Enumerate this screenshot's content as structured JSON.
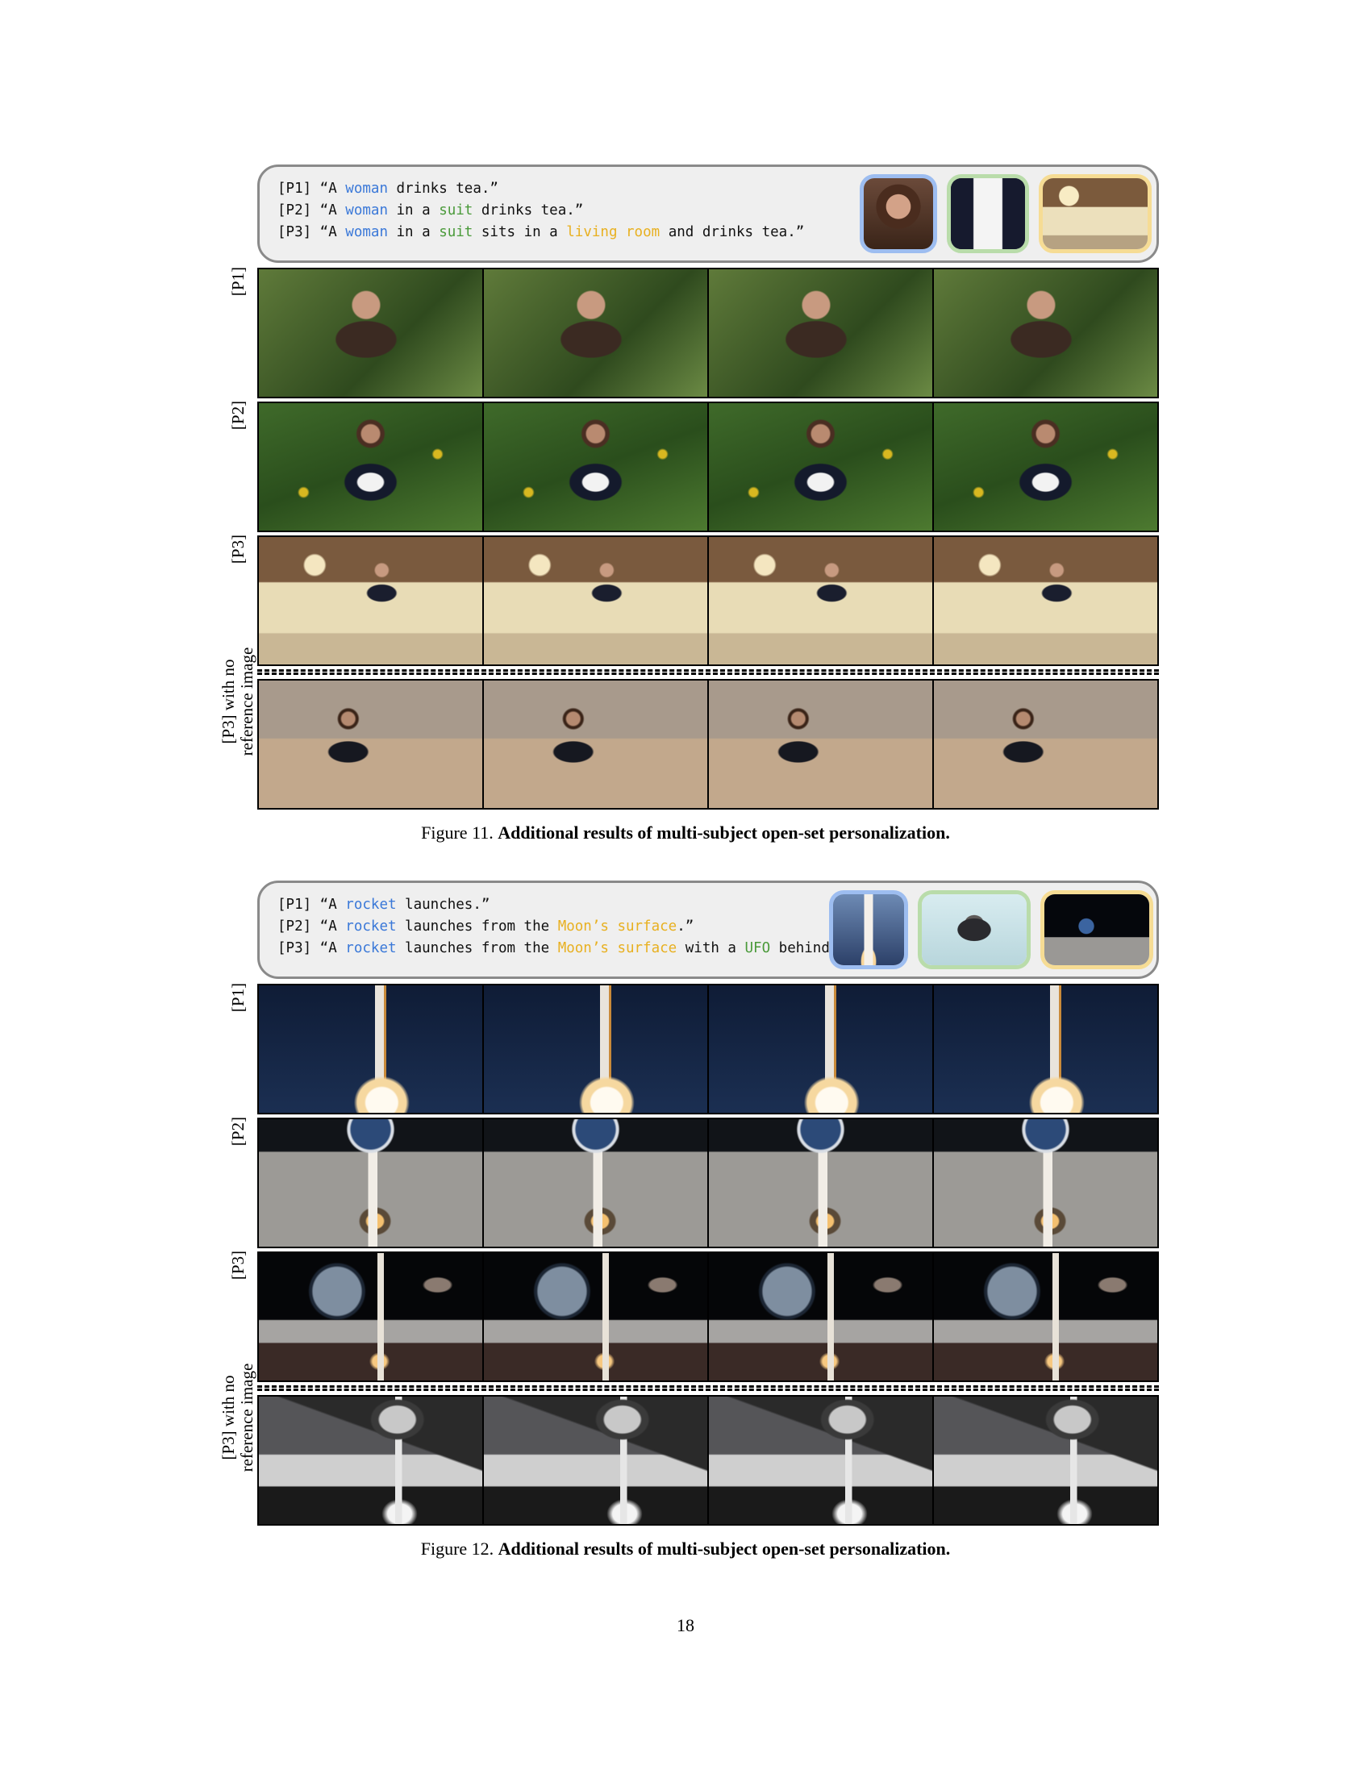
{
  "figures": [
    {
      "prompts": [
        [
          {
            "text": "[P1] “A ",
            "color": "#111111"
          },
          {
            "text": "woman",
            "color": "#3a78d8"
          },
          {
            "text": " drinks tea.”",
            "color": "#111111"
          }
        ],
        [
          {
            "text": "[P2] “A ",
            "color": "#111111"
          },
          {
            "text": "woman",
            "color": "#3a78d8"
          },
          {
            "text": " in a ",
            "color": "#111111"
          },
          {
            "text": "suit",
            "color": "#4a9a3a"
          },
          {
            "text": " drinks tea.”",
            "color": "#111111"
          }
        ],
        [
          {
            "text": "[P3] “A ",
            "color": "#111111"
          },
          {
            "text": "woman",
            "color": "#3a78d8"
          },
          {
            "text": " in a ",
            "color": "#111111"
          },
          {
            "text": "suit",
            "color": "#4a9a3a"
          },
          {
            "text": " sits in a ",
            "color": "#111111"
          },
          {
            "text": "living room",
            "color": "#e8b020"
          },
          {
            "text": " and drinks tea.”",
            "color": "#111111"
          }
        ]
      ],
      "rows": [
        {
          "label": "[P1]"
        },
        {
          "label": "[P2]"
        },
        {
          "label": "[P3]"
        },
        {
          "label_line1": "[P3] with no",
          "label_line2": "reference image"
        }
      ],
      "caption_prefix": "Figure 11.",
      "caption_bold": "Additional results of multi-subject open-set personalization."
    },
    {
      "prompts": [
        [
          {
            "text": "[P1] “A ",
            "color": "#111111"
          },
          {
            "text": "rocket",
            "color": "#3a78d8"
          },
          {
            "text": " launches.”",
            "color": "#111111"
          }
        ],
        [
          {
            "text": "[P2] “A ",
            "color": "#111111"
          },
          {
            "text": "rocket",
            "color": "#3a78d8"
          },
          {
            "text": " launches from the ",
            "color": "#111111"
          },
          {
            "text": "Moon’s surface",
            "color": "#e8b020"
          },
          {
            "text": ".”",
            "color": "#111111"
          }
        ],
        [
          {
            "text": "[P3] “A ",
            "color": "#111111"
          },
          {
            "text": "rocket",
            "color": "#3a78d8"
          },
          {
            "text": " launches from the ",
            "color": "#111111"
          },
          {
            "text": "Moon’s surface",
            "color": "#e8b020"
          },
          {
            "text": " with a ",
            "color": "#111111"
          },
          {
            "text": "UFO",
            "color": "#4a9a3a"
          },
          {
            "text": " behind.”",
            "color": "#111111"
          }
        ]
      ],
      "rows": [
        {
          "label": "[P1]"
        },
        {
          "label": "[P2]"
        },
        {
          "label": "[P3]"
        },
        {
          "label_line1": "[P3] with no",
          "label_line2": "reference image"
        }
      ],
      "caption_prefix": "Figure 12.",
      "caption_bold": "Additional results of multi-subject open-set personalization."
    }
  ],
  "colors": {
    "ref_blue": "#9dbdf0",
    "ref_green": "#b9dcaa",
    "ref_yellow": "#f6dc94"
  },
  "page_number": "18"
}
